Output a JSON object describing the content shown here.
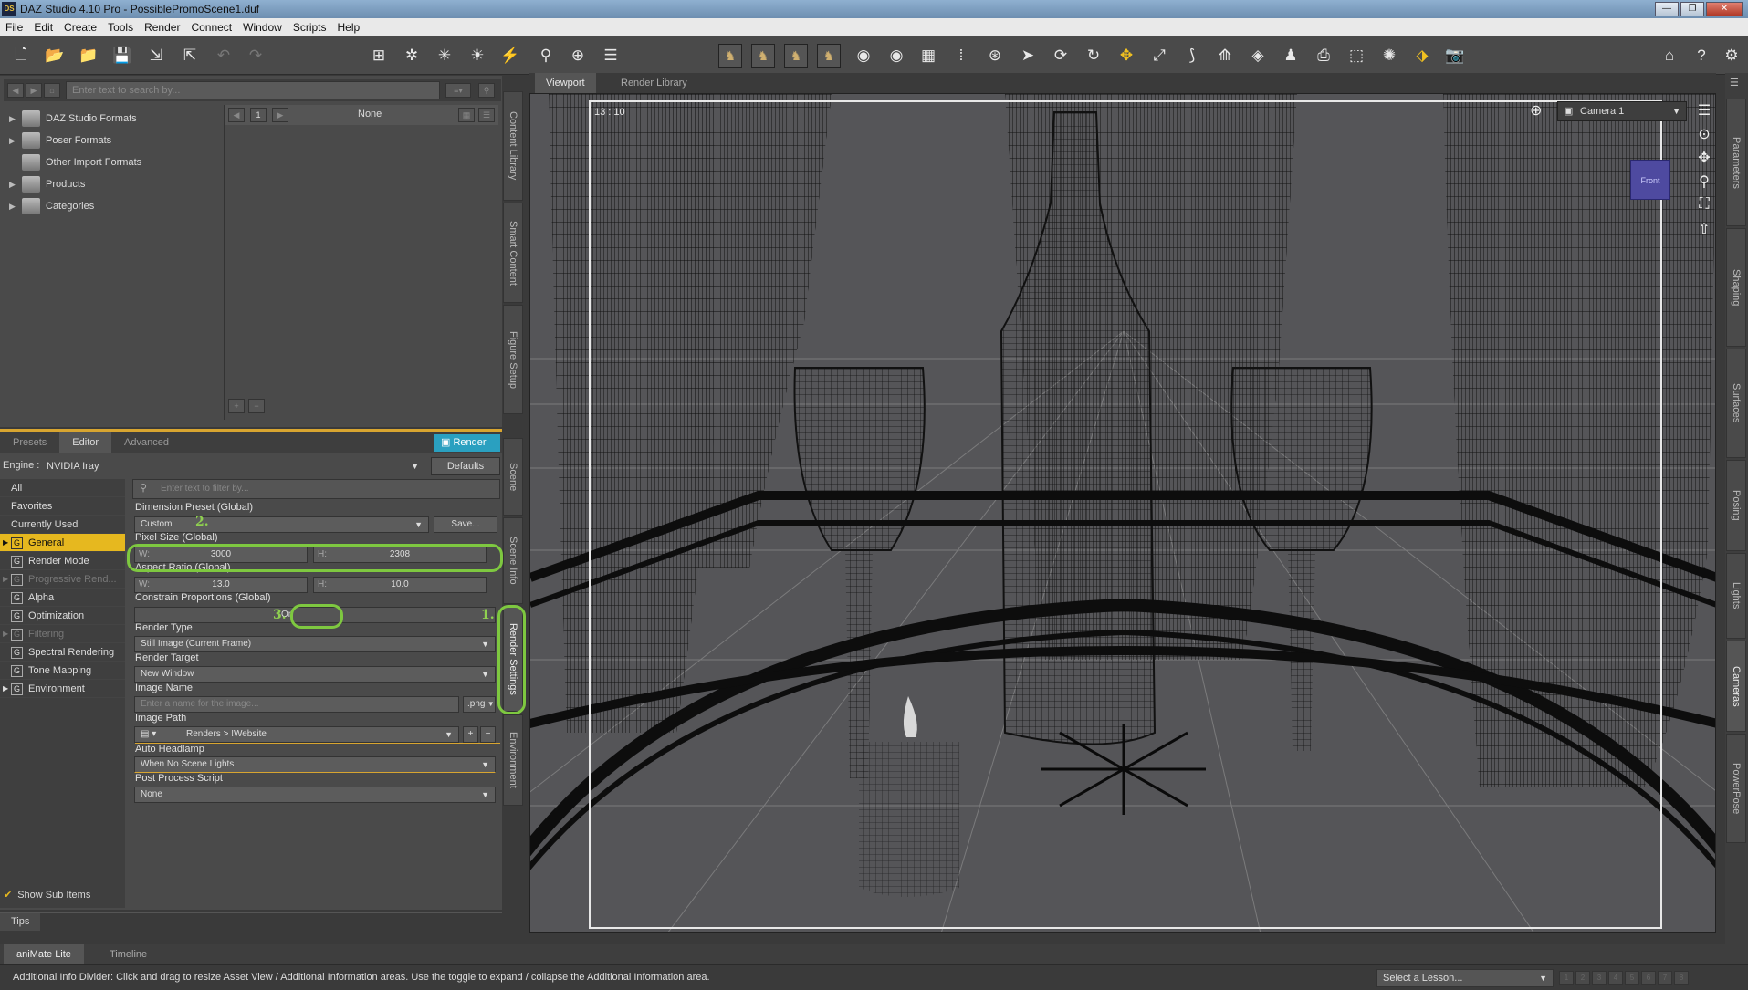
{
  "window": {
    "title": "DAZ Studio 4.10 Pro - PossiblePromoScene1.duf",
    "logo_text": "DS"
  },
  "menu": [
    "File",
    "Edit",
    "Create",
    "Tools",
    "Render",
    "Connect",
    "Window",
    "Scripts",
    "Help"
  ],
  "content_library": {
    "search_placeholder": "Enter text to search by...",
    "tree": [
      "DAZ Studio Formats",
      "Poser Formats",
      "Other Import Formats",
      "Products",
      "Categories"
    ],
    "page_number": "1",
    "filter_value": "None",
    "add_label": "+",
    "remove_label": "−"
  },
  "side_tabs_left": [
    "Content Library",
    "Smart Content",
    "Figure Setup",
    "Scene",
    "Scene Info",
    "Render Settings",
    "Environment"
  ],
  "render_panel": {
    "tabs": [
      "Presets",
      "Editor",
      "Advanced"
    ],
    "render_button": "Render",
    "engine_label": "Engine :",
    "engine_value": "NVIDIA Iray",
    "defaults_button": "Defaults",
    "filter_placeholder": "Enter text to filter by...",
    "categories": [
      "All",
      "Favorites",
      "Currently Used",
      "General",
      "Render Mode",
      "Progressive Rend...",
      "Alpha",
      "Optimization",
      "Filtering",
      "Spectral Rendering",
      "Tone Mapping",
      "Environment"
    ],
    "category_icon": "G",
    "dimension_preset_label": "Dimension Preset (Global)",
    "dimension_preset_value": "Custom",
    "save_button": "Save...",
    "pixel_size_label": "Pixel Size (Global)",
    "w_label": "W:",
    "h_label": "H:",
    "pixel_w": "3000",
    "pixel_h": "2308",
    "aspect_label": "Aspect Ratio (Global)",
    "aspect_w": "13.0",
    "aspect_h": "10.0",
    "constrain_label": "Constrain Proportions (Global)",
    "constrain_value": "On",
    "render_type_label": "Render Type",
    "render_type_value": "Still Image (Current Frame)",
    "render_target_label": "Render Target",
    "render_target_value": "New Window",
    "image_name_label": "Image Name",
    "image_name_placeholder": "Enter a name for the image...",
    "image_ext": ".png",
    "image_path_label": "Image Path",
    "image_path_value": "Renders > !Website",
    "headlamp_label": "Auto Headlamp",
    "headlamp_value": "When No Scene Lights",
    "post_script_label": "Post Process Script",
    "post_script_value": "None",
    "show_sub_items": "Show Sub Items",
    "annotations": [
      "1.",
      "2.",
      "3."
    ],
    "tips_tab": "Tips"
  },
  "viewport": {
    "tabs": [
      "Viewport",
      "Render Library"
    ],
    "aspect_readout": "13 : 10",
    "camera": "Camera 1",
    "navcube_label": "Front"
  },
  "side_tabs_right": [
    "Parameters",
    "Shaping",
    "Surfaces",
    "Posing",
    "Lights",
    "Cameras",
    "PowerPose"
  ],
  "bottom": {
    "tabs": [
      "aniMate Lite",
      "Timeline"
    ],
    "status": "Additional Info Divider: Click and drag to resize Asset View / Additional Information areas. Use the toggle to expand / collapse the Additional Information area.",
    "lesson_placeholder": "Select a Lesson...",
    "pages": [
      "1",
      "2",
      "3",
      "4",
      "5",
      "6",
      "7",
      "8"
    ]
  },
  "colors": {
    "accent_yellow": "#e6b81f",
    "render_blue": "#2aa0c0",
    "annotation_green": "#7ec840",
    "wire": "#111111"
  }
}
